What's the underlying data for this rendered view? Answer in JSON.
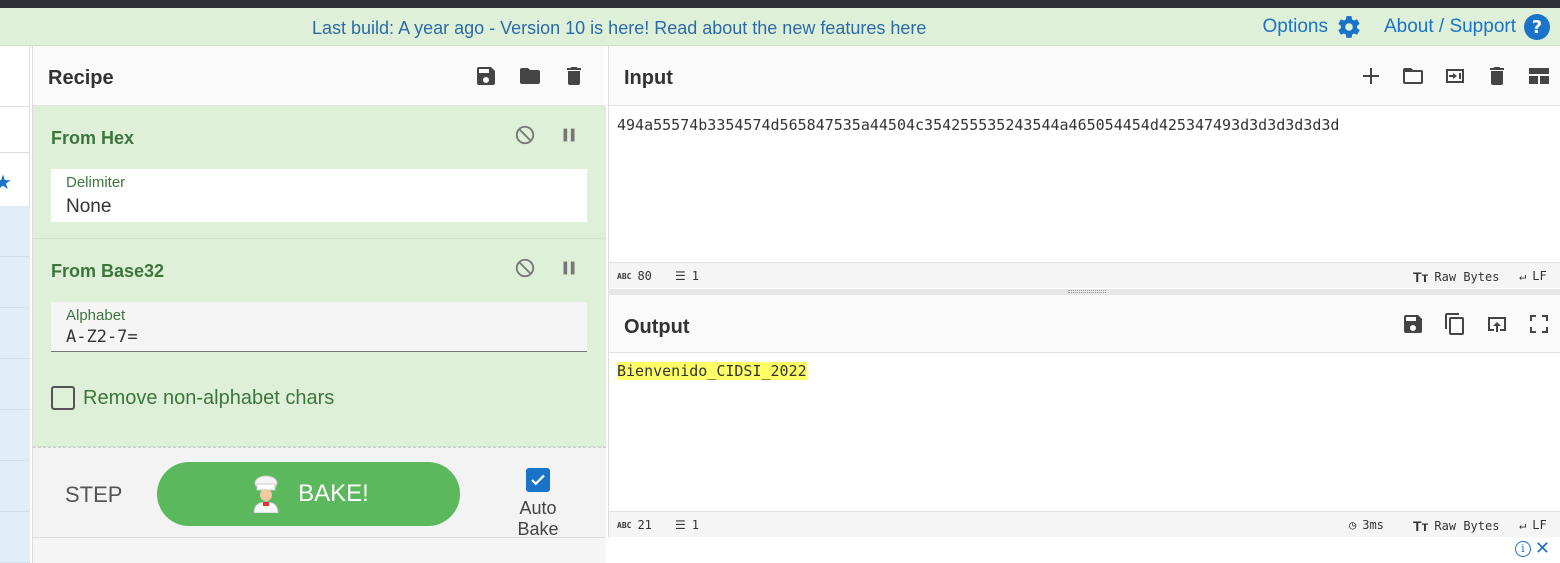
{
  "banner": {
    "message": "Last build: A year ago - Version 10 is here! Read about the new features ",
    "link": "here",
    "options_label": "Options",
    "about_label": "About / Support",
    "help_glyph": "?"
  },
  "recipe": {
    "title": "Recipe",
    "operations": [
      {
        "name": "From Hex",
        "arg_label": "Delimiter",
        "arg_value": "None"
      },
      {
        "name": "From Base32",
        "arg_label": "Alphabet",
        "arg_value": "A-Z2-7=",
        "checkbox_label": "Remove non-alphabet chars",
        "checkbox_checked": false
      }
    ],
    "step_label": "STEP",
    "bake_label": "BAKE!",
    "auto_bake_label": "Auto Bake",
    "auto_bake_checked": true
  },
  "input": {
    "title": "Input",
    "text": "494a55574b3354574d565847535a44504c354255535243544a465054454d425347493d3d3d3d3d3d",
    "status": {
      "length": "80",
      "lines": "1",
      "encoding": "Raw Bytes",
      "eol": "LF"
    }
  },
  "output": {
    "title": "Output",
    "text": "Bienvenido_CIDSI_2022",
    "status": {
      "length": "21",
      "lines": "1",
      "time": "3ms",
      "encoding": "Raw Bytes",
      "eol": "LF"
    }
  },
  "colors": {
    "accent": "#1a73c8",
    "op_background": "#dff0d8",
    "op_title": "#3c763d",
    "bake_button": "#5cb85c",
    "highlight": "#ffff66"
  }
}
